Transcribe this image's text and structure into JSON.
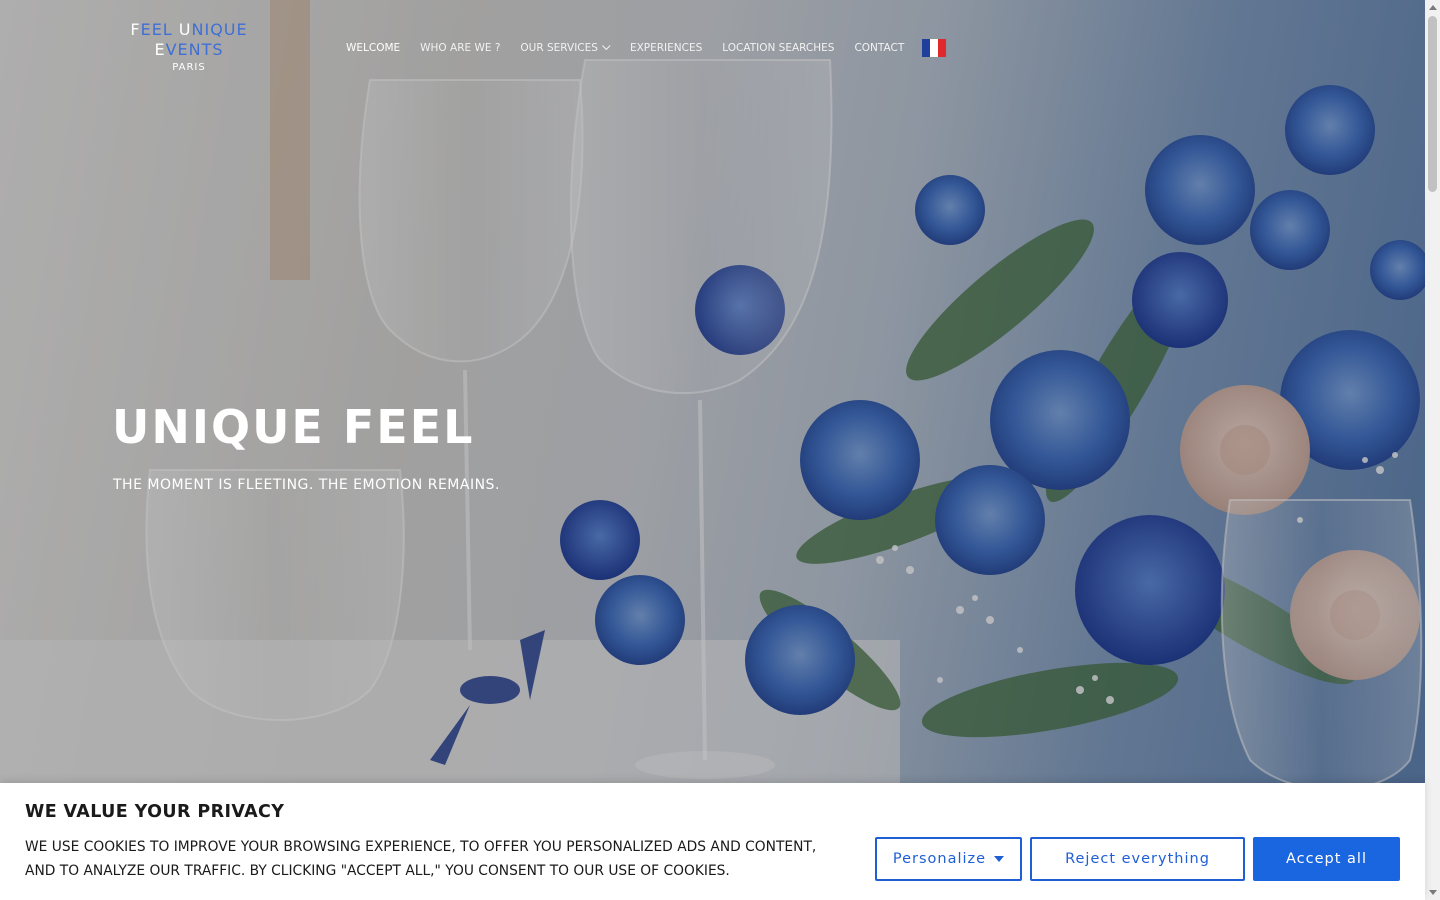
{
  "logo": {
    "line1_parts": [
      {
        "text": "F",
        "accent": false
      },
      {
        "text": "EEL ",
        "accent": true
      },
      {
        "text": "U",
        "accent": false
      },
      {
        "text": "N",
        "accent": true
      },
      {
        "text": "IQUE",
        "accent": true
      }
    ],
    "line2_parts": [
      {
        "text": "E",
        "accent": false
      },
      {
        "text": "VENTS",
        "accent": true
      }
    ],
    "line3": "PARIS"
  },
  "nav": {
    "welcome": "WELCOME",
    "who": "WHO ARE WE ?",
    "services": "OUR SERVICES",
    "experiences": "EXPERIENCES",
    "locations": "LOCATION SEARCHES",
    "contact": "CONTACT",
    "language_flag": "french-flag-icon"
  },
  "hero": {
    "title": "UNIQUE FEEL",
    "subtitle": "THE MOMENT IS FLEETING. THE EMOTION REMAINS."
  },
  "cookie_banner": {
    "title": "WE VALUE YOUR PRIVACY",
    "text": "WE USE COOKIES TO IMPROVE YOUR BROWSING EXPERIENCE, TO OFFER YOU PERSONALIZED ADS AND CONTENT, AND TO ANALYZE OUR TRAFFIC. BY CLICKING \"ACCEPT ALL,\" YOU CONSENT TO OUR USE OF COOKIES.",
    "personalize": "Personalize",
    "reject": "Reject everything",
    "accept": "Accept all"
  },
  "colors": {
    "accent": "#1a66e0",
    "logo_accent": "#3f6fd4",
    "flag_blue": "#1f3f9a",
    "flag_white": "#ffffff",
    "flag_red": "#e0292c"
  }
}
